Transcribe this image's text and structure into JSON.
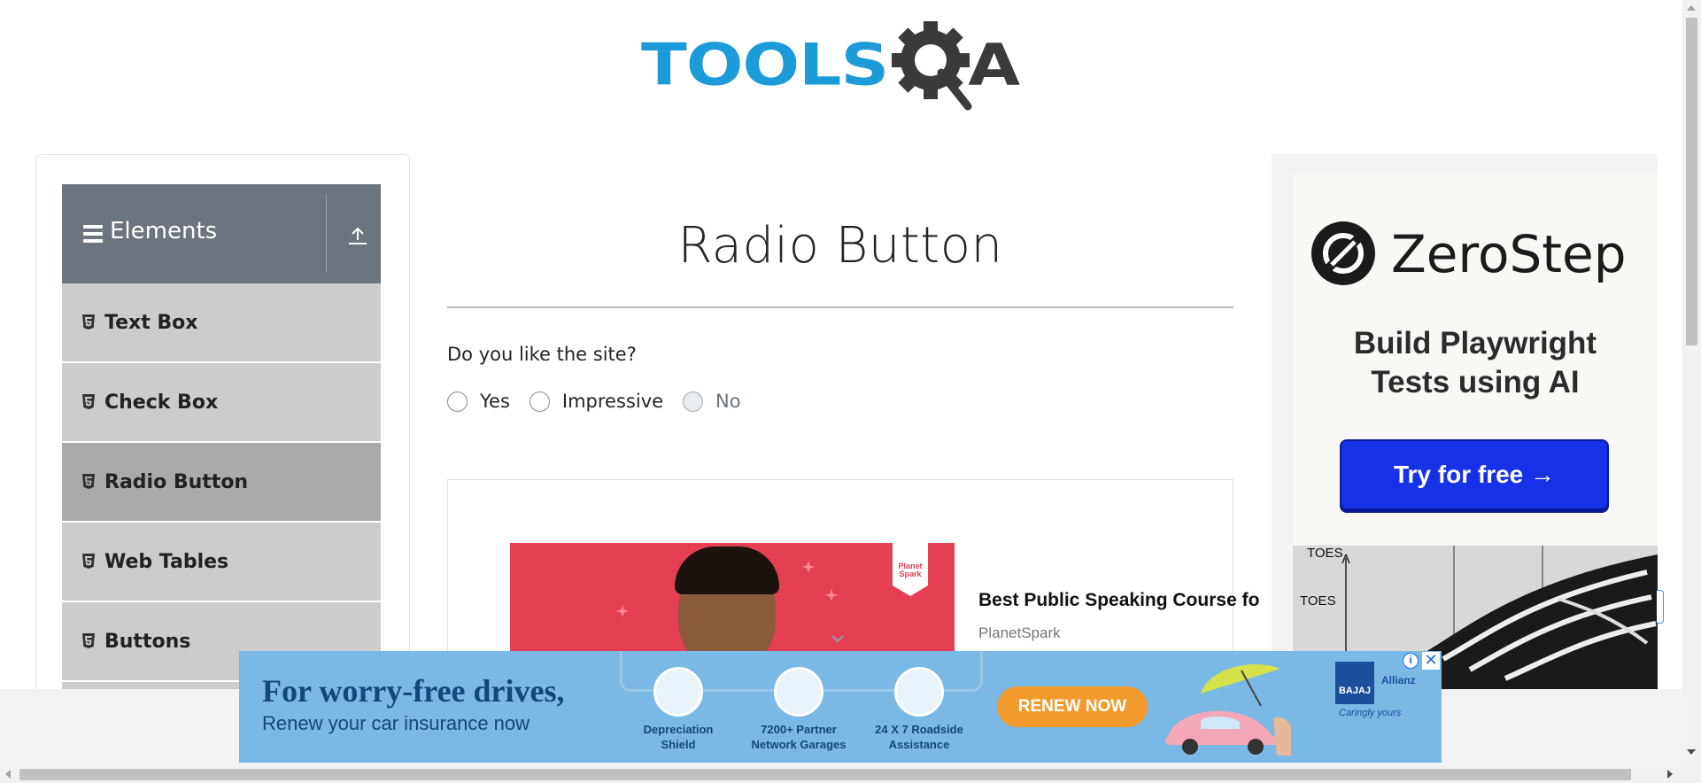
{
  "header": {
    "logo_left": "TOOLS",
    "logo_right": "A"
  },
  "sidebar": {
    "group_title": "Elements",
    "items": [
      {
        "label": "Text Box"
      },
      {
        "label": "Check Box"
      },
      {
        "label": "Radio Button",
        "active": true
      },
      {
        "label": "Web Tables"
      },
      {
        "label": "Buttons"
      }
    ]
  },
  "main": {
    "title": "Radio Button",
    "question": "Do you like the site?",
    "options": [
      {
        "label": "Yes",
        "disabled": false
      },
      {
        "label": "Impressive",
        "disabled": false
      },
      {
        "label": "No",
        "disabled": true
      }
    ]
  },
  "native_ad": {
    "title": "Best Public Speaking Course fo",
    "brand": "PlanetSpark",
    "badge": "Planet Spark"
  },
  "right_ad": {
    "brand": "ZeroStep",
    "subtitle_line1": "Build Playwright",
    "subtitle_line2": "Tests using AI",
    "button": "Try for free →",
    "xray_label_1": "TOES",
    "xray_label_2": "TOES"
  },
  "bottom_ad": {
    "headline": "For worry-free drives,",
    "subline": "Renew your car insurance now",
    "features": [
      {
        "line1": "Depreciation",
        "line2": "Shield"
      },
      {
        "line1": "7200+ Partner",
        "line2": "Network Garages"
      },
      {
        "line1": "24 X 7 Roadside",
        "line2": "Assistance"
      }
    ],
    "cta": "RENEW NOW",
    "brand1": "BAJAJ",
    "brand2": "Allianz",
    "tagline": "Caringly yours"
  },
  "colors": {
    "brand_blue": "#1b9bd7",
    "sidebar_header": "#6c757d",
    "menu_item": "#cccccc",
    "menu_active": "#aaaaaa",
    "cta_blue": "#1532e6"
  }
}
